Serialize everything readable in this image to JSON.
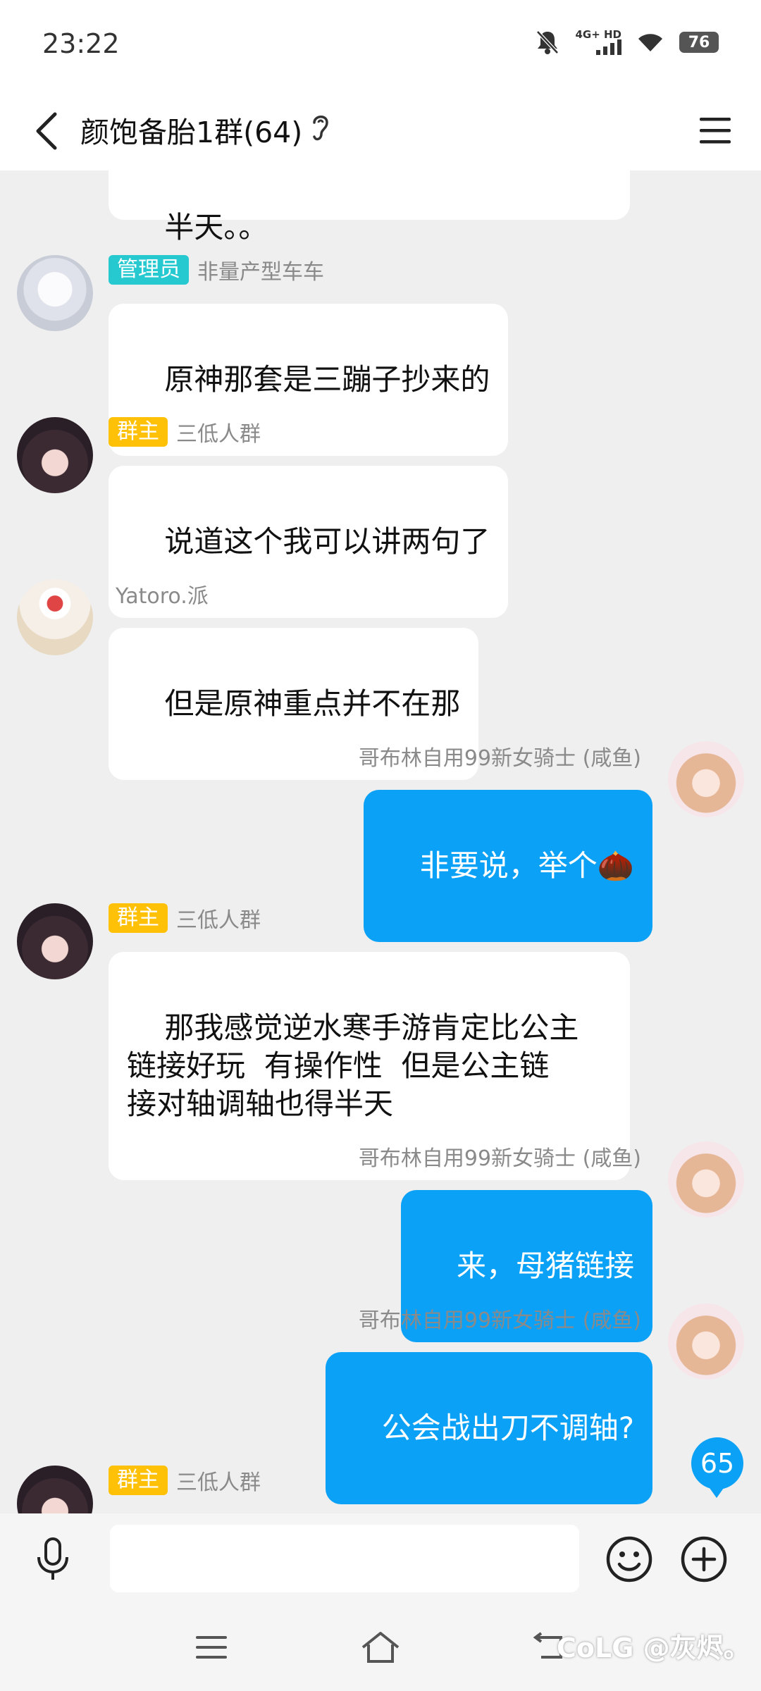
{
  "status": {
    "time": "23:22",
    "network": "4G+ HD",
    "battery": "76"
  },
  "header": {
    "title": "颜饱备胎1群(64)"
  },
  "messages": [
    {
      "text": "半天。。"
    },
    {
      "badge": "管理员",
      "sender": "非量产型车车",
      "text": "原神那套是三蹦子抄来的"
    },
    {
      "badge": "群主",
      "sender": "三低人群",
      "text": "说道这个我可以讲两句了"
    },
    {
      "sender": "Yatoro.派",
      "text": "但是原神重点并不在那"
    },
    {
      "sender": "哥布林自用99新女骑士 (咸鱼)",
      "text": "非要说，举个",
      "emoji": "🌰"
    },
    {
      "badge": "群主",
      "sender": "三低人群",
      "text": "那我感觉逆水寒手游肯定比公主\n链接好玩  有操作性  但是公主链\n接对轴调轴也得半天"
    },
    {
      "sender": "哥布林自用99新女骑士 (咸鱼)",
      "text": "来，母猪链接"
    },
    {
      "sender": "哥布林自用99新女骑士 (咸鱼)",
      "text": "公会战出刀不调轴?"
    },
    {
      "badge": "群主",
      "sender": "三低人群"
    }
  ],
  "unread_count": "65",
  "input": {
    "placeholder": ""
  },
  "watermark": "CoLG @灰烬。"
}
